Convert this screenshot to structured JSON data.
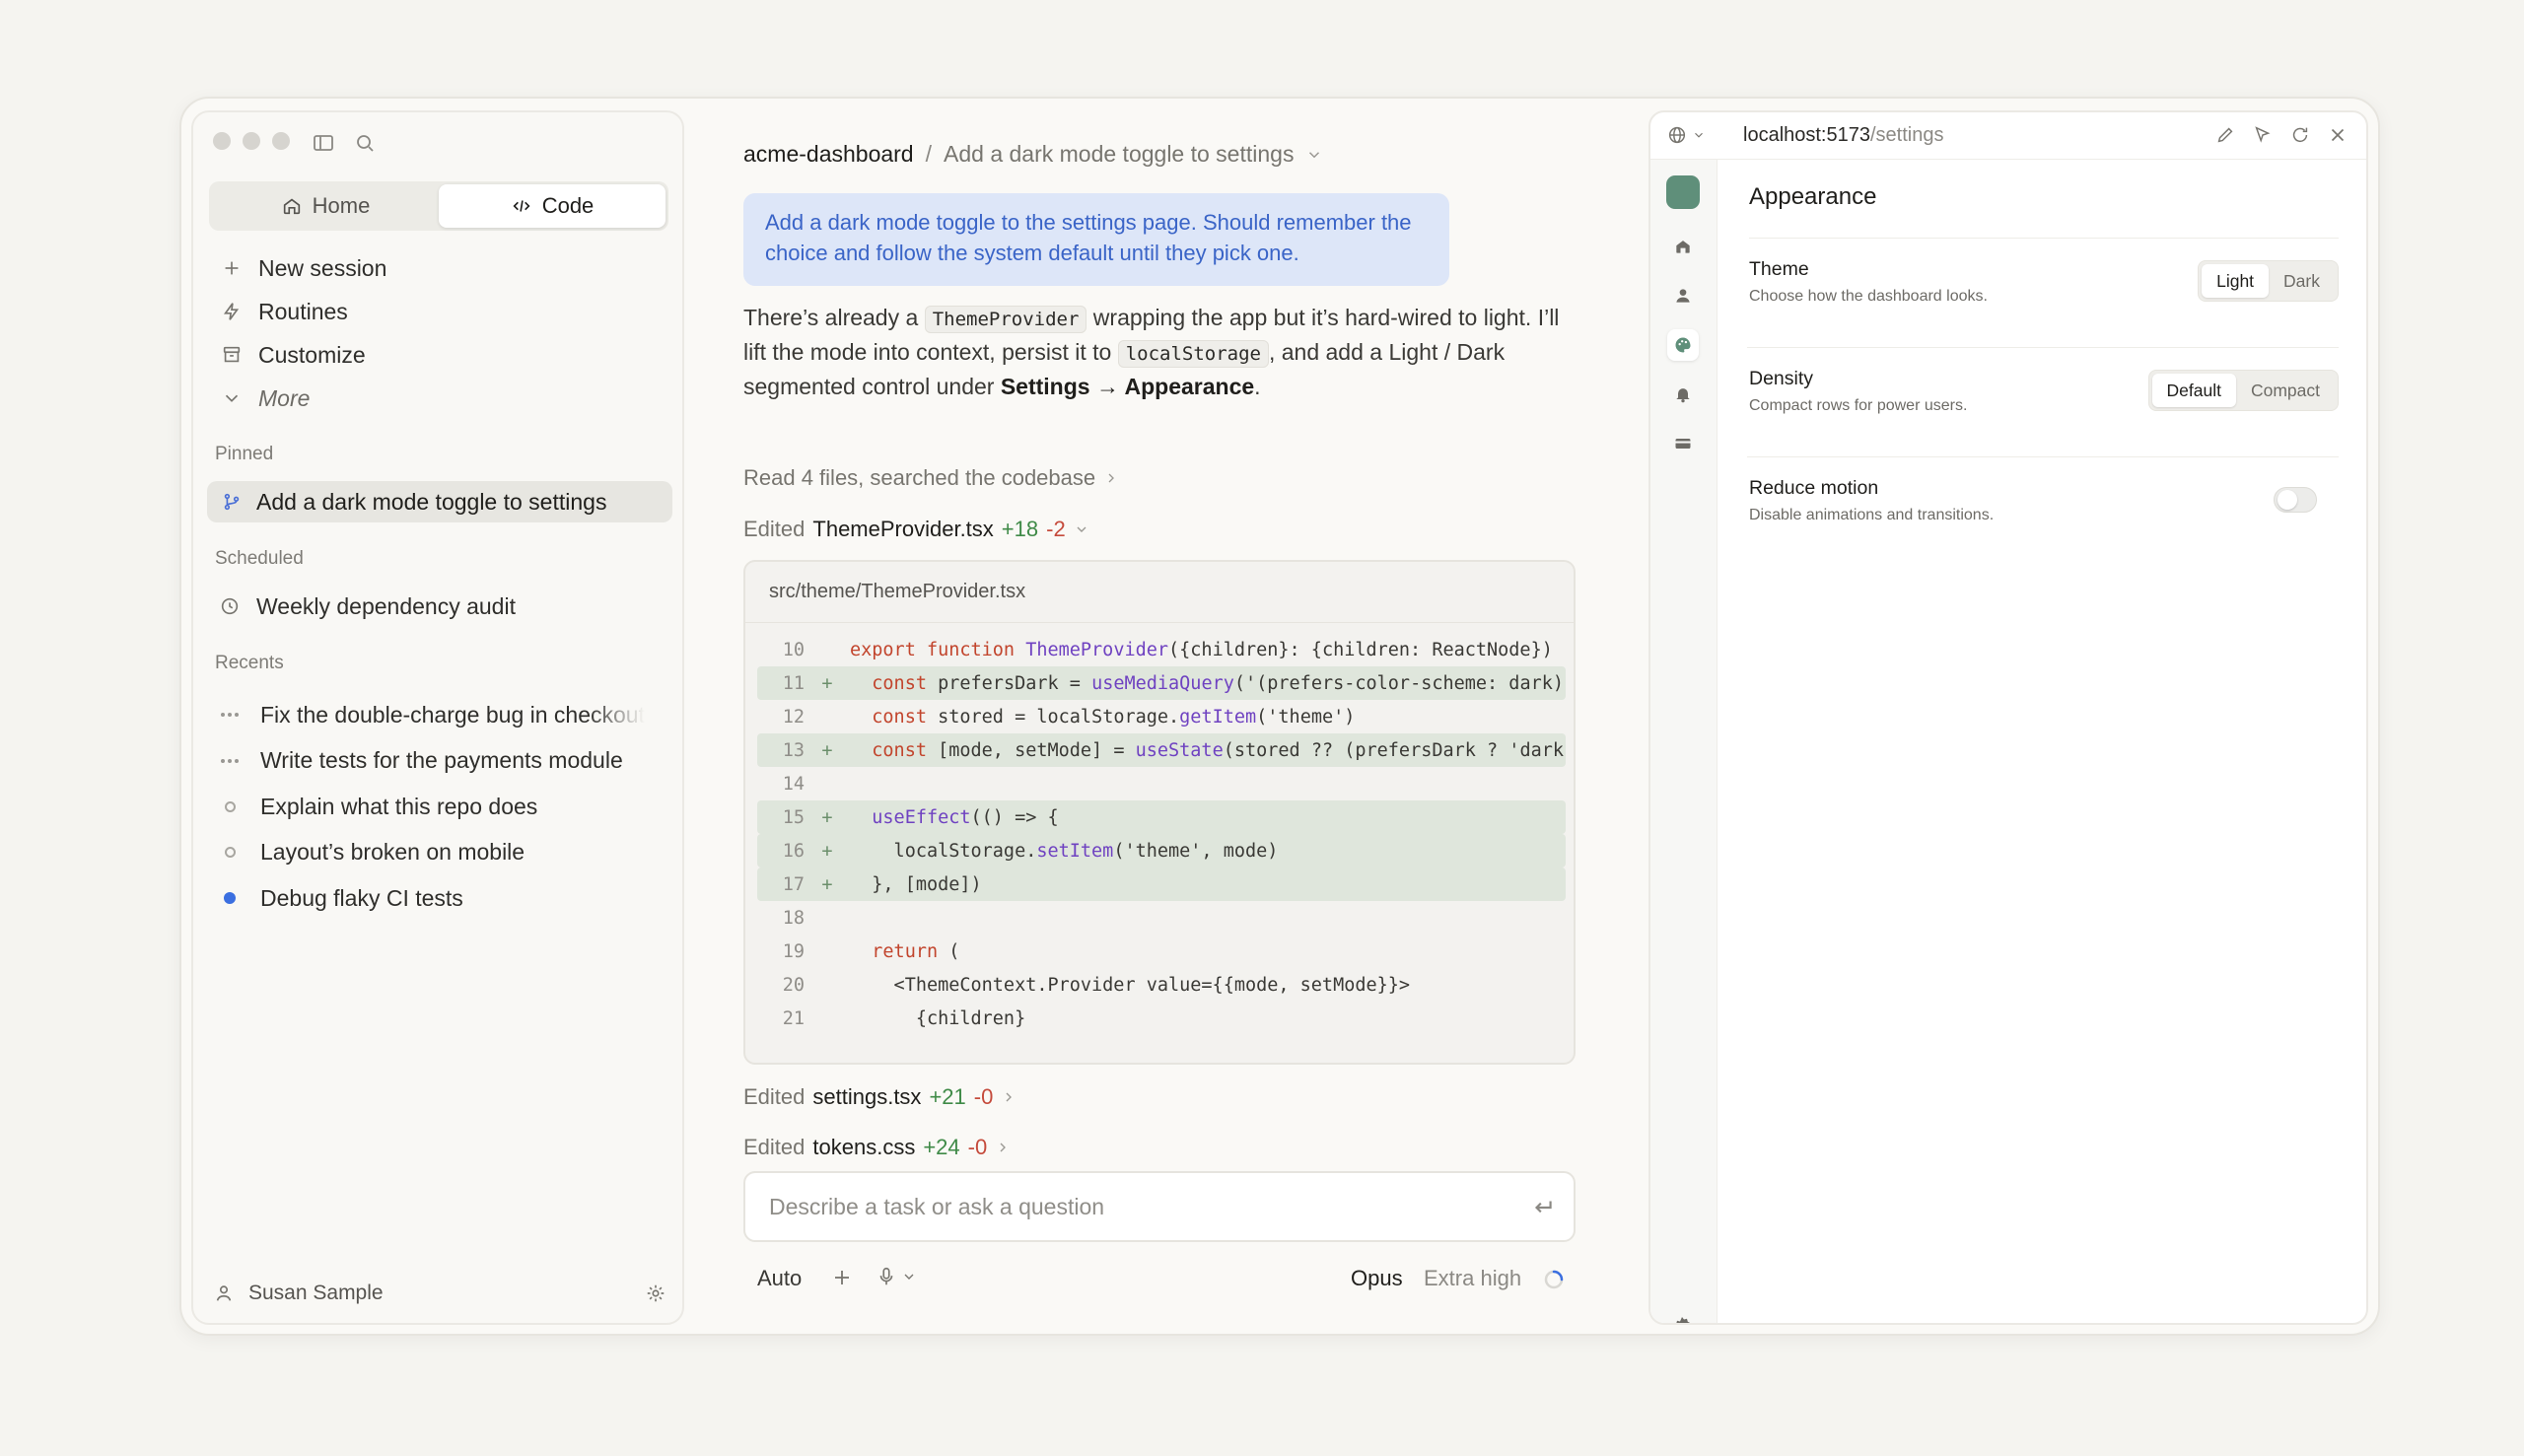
{
  "sidebar": {
    "tabs": [
      {
        "label": "Home",
        "icon": "home-icon",
        "active": false
      },
      {
        "label": "Code",
        "icon": "code-icon",
        "active": true
      }
    ],
    "nav": [
      {
        "label": "New session",
        "icon": "plus-icon"
      },
      {
        "label": "Routines",
        "icon": "bolt-icon"
      },
      {
        "label": "Customize",
        "icon": "archive-icon"
      },
      {
        "label": "More",
        "icon": "chevron-down-icon"
      }
    ],
    "pinned_label": "Pinned",
    "pinned_item": "Add a dark mode toggle to settings",
    "scheduled_label": "Scheduled",
    "scheduled_item": "Weekly dependency audit",
    "recents_label": "Recents",
    "recents": [
      {
        "label": "Fix the double-charge bug in checkout",
        "status": "running"
      },
      {
        "label": "Write tests for the payments module",
        "status": "running"
      },
      {
        "label": "Explain what this repo does",
        "status": "idle"
      },
      {
        "label": "Layout’s broken on mobile",
        "status": "idle"
      },
      {
        "label": "Debug flaky CI tests",
        "status": "unread"
      }
    ],
    "user_name": "Susan Sample"
  },
  "main": {
    "repo": "acme-dashboard",
    "separator": "/",
    "session_title": "Add a dark mode toggle to settings",
    "user_message": "Add a dark mode toggle to the settings page. Should remember the choice and follow the system default until they pick one.",
    "reply": {
      "t1": "There’s already a ",
      "c1": "ThemeProvider",
      "t2": " wrapping the app but it’s hard-wired to light. I’ll lift the mode into context, persist it to ",
      "c2": "localStorage",
      "t3": ", and add a Light / Dark segmented control under ",
      "b1": "Settings → Appearance",
      "t4": "."
    },
    "read_summary": "Read 4 files, searched the codebase",
    "edits": [
      {
        "prefix": "Edited",
        "file": "ThemeProvider.tsx",
        "added": "+18",
        "removed": "-2"
      },
      {
        "prefix": "Edited",
        "file": "settings.tsx",
        "added": "+21",
        "removed": "-0"
      },
      {
        "prefix": "Edited",
        "file": "tokens.css",
        "added": "+24",
        "removed": "-0"
      }
    ],
    "code_path": "src/theme/ThemeProvider.tsx",
    "code_lines": [
      {
        "n": "10",
        "mark": "",
        "added": false,
        "text": "export function ThemeProvider({children}: {children: ReactNode})"
      },
      {
        "n": "11",
        "mark": "+",
        "added": true,
        "text": "  const prefersDark = useMediaQuery('(prefers-color-scheme: dark)')"
      },
      {
        "n": "12",
        "mark": "",
        "added": false,
        "text": "  const stored = localStorage.getItem('theme')"
      },
      {
        "n": "13",
        "mark": "+",
        "added": true,
        "text": "  const [mode, setMode] = useState(stored ?? (prefersDark ? 'dark' : 'light'))"
      },
      {
        "n": "14",
        "mark": "",
        "added": false,
        "text": ""
      },
      {
        "n": "15",
        "mark": "+",
        "added": true,
        "text": "  useEffect(() => {"
      },
      {
        "n": "16",
        "mark": "+",
        "added": true,
        "text": "    localStorage.setItem('theme', mode)"
      },
      {
        "n": "17",
        "mark": "+",
        "added": true,
        "text": "  }, [mode])"
      },
      {
        "n": "18",
        "mark": "",
        "added": false,
        "text": ""
      },
      {
        "n": "19",
        "mark": "",
        "added": false,
        "text": "  return ("
      },
      {
        "n": "20",
        "mark": "",
        "added": false,
        "text": "    <ThemeContext.Provider value={{mode, setMode}}>"
      },
      {
        "n": "21",
        "mark": "",
        "added": false,
        "text": "      {children}"
      }
    ],
    "input_placeholder": "Describe a task or ask a question",
    "composer": {
      "mode": "Auto",
      "model": "Opus",
      "effort": "Extra high"
    }
  },
  "browser": {
    "url_host": "localhost:5173",
    "url_path": "/settings",
    "section_title": "Appearance",
    "settings": {
      "theme": {
        "label": "Theme",
        "desc": "Choose how the dashboard looks.",
        "options": [
          "Light",
          "Dark"
        ],
        "selected": "Light"
      },
      "density": {
        "label": "Density",
        "desc": "Compact rows for power users.",
        "options": [
          "Default",
          "Compact"
        ],
        "selected": "Default"
      },
      "motion": {
        "label": "Reduce motion",
        "desc": "Disable animations and transitions.",
        "enabled": false
      }
    }
  },
  "colors": {
    "accent_blue": "#3b6fe0",
    "added_green": "#3f8a47",
    "removed_red": "#c54b3c",
    "app_brand": "#5f8f7a"
  }
}
